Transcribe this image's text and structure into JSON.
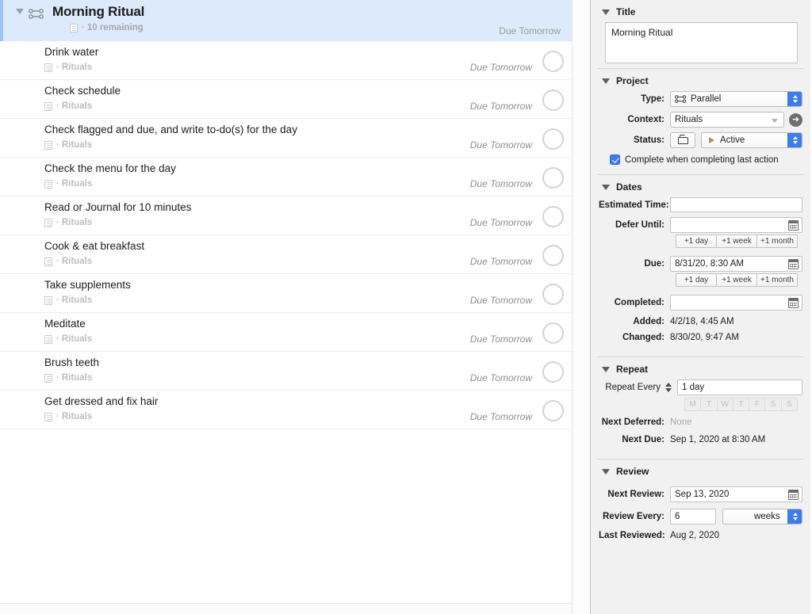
{
  "outline": {
    "project_header": {
      "title": "Morning Ritual",
      "icon": "parallel-project-icon",
      "disclosure": "chevron-down-icon",
      "remaining": "10 remaining",
      "separator": "·",
      "due": "Due Tomorrow"
    },
    "tasks": [
      {
        "title": "Drink water",
        "context": "Rituals",
        "due": "Due Tomorrow"
      },
      {
        "title": "Check schedule",
        "context": "Rituals",
        "due": "Due Tomorrow"
      },
      {
        "title": "Check flagged and due, and write to-do(s) for the day",
        "context": "Rituals",
        "due": "Due Tomorrow"
      },
      {
        "title": "Check the menu for the day",
        "context": "Rituals",
        "due": "Due Tomorrow"
      },
      {
        "title": "Read or Journal for 10 minutes",
        "context": "Rituals",
        "due": "Due Tomorrow"
      },
      {
        "title": "Cook & eat breakfast",
        "context": "Rituals",
        "due": "Due Tomorrow"
      },
      {
        "title": "Take supplements",
        "context": "Rituals",
        "due": "Due Tomorrow"
      },
      {
        "title": "Meditate",
        "context": "Rituals",
        "due": "Due Tomorrow"
      },
      {
        "title": "Brush teeth",
        "context": "Rituals",
        "due": "Due Tomorrow"
      },
      {
        "title": "Get dressed and fix hair",
        "context": "Rituals",
        "due": "Due Tomorrow"
      }
    ],
    "separator": "·",
    "status_bar": ""
  },
  "inspector": {
    "title_section": {
      "heading": "Title",
      "value": "Morning Ritual"
    },
    "project_section": {
      "heading": "Project",
      "type_label": "Type:",
      "type_value": "Parallel",
      "context_label": "Context:",
      "context_value": "Rituals",
      "status_label": "Status:",
      "status_value": "Active",
      "complete_checkbox_label": "Complete when completing last action",
      "complete_checkbox_checked": true
    },
    "dates_section": {
      "heading": "Dates",
      "estimated_time_label": "Estimated Time:",
      "estimated_time_value": "",
      "defer_until_label": "Defer Until:",
      "defer_until_value": "",
      "due_label": "Due:",
      "due_value": "8/31/20, 8:30 AM",
      "completed_label": "Completed:",
      "completed_value": "",
      "added_label": "Added:",
      "added_value": "4/2/18, 4:45 AM",
      "changed_label": "Changed:",
      "changed_value": "8/30/20, 9:47 AM",
      "bump_buttons": [
        "+1 day",
        "+1 week",
        "+1 month"
      ]
    },
    "repeat_section": {
      "heading": "Repeat",
      "repeat_every_label": "Repeat Every",
      "repeat_every_value": "1 day",
      "weekdays": [
        "M",
        "T",
        "W",
        "T",
        "F",
        "S",
        "S"
      ],
      "next_deferred_label": "Next Deferred:",
      "next_deferred_value": "None",
      "next_due_label": "Next Due:",
      "next_due_value": "Sep 1, 2020 at 8:30 AM"
    },
    "review_section": {
      "heading": "Review",
      "next_review_label": "Next Review:",
      "next_review_value": "Sep 13, 2020",
      "review_every_label": "Review Every:",
      "review_every_count": "6",
      "review_every_unit": "weeks",
      "last_reviewed_label": "Last Reviewed:",
      "last_reviewed_value": "Aug 2, 2020"
    }
  },
  "colors": {
    "selection_blue": "#ddeafb",
    "selection_border": "#9cc4ef",
    "accent_blue": "#3c7ceb",
    "inspector_bg": "#f1f1f1",
    "muted_text": "#a6a8ab"
  }
}
